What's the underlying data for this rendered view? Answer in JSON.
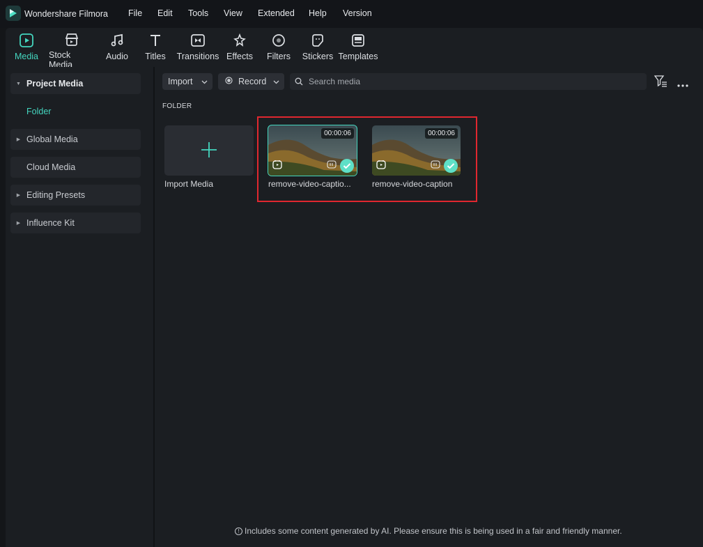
{
  "app": {
    "title": "Wondershare Filmora",
    "menu": [
      "File",
      "Edit",
      "Tools",
      "View",
      "Extended",
      "Help",
      "Version"
    ]
  },
  "toolbar": {
    "tabs": [
      {
        "label": "Media",
        "icon": "media-icon",
        "active": true
      },
      {
        "label": "Stock Media",
        "icon": "stock-media-icon"
      },
      {
        "label": "Audio",
        "icon": "audio-icon"
      },
      {
        "label": "Titles",
        "icon": "titles-icon"
      },
      {
        "label": "Transitions",
        "icon": "transitions-icon"
      },
      {
        "label": "Effects",
        "icon": "effects-icon"
      },
      {
        "label": "Filters",
        "icon": "filters-icon"
      },
      {
        "label": "Stickers",
        "icon": "stickers-icon"
      },
      {
        "label": "Templates",
        "icon": "templates-icon"
      }
    ]
  },
  "sidebar": {
    "project_media": "Project Media",
    "folder": "Folder",
    "global_media": "Global Media",
    "cloud_media": "Cloud Media",
    "editing_presets": "Editing Presets",
    "influence_kit": "Influence Kit"
  },
  "main": {
    "import_label": "Import",
    "record_label": "Record",
    "search_placeholder": "Search media",
    "folder_header": "FOLDER",
    "import_media_label": "Import Media",
    "clips": [
      {
        "name": "remove-video-captio...",
        "duration": "00:00:06",
        "selected": true
      },
      {
        "name": "remove-video-caption",
        "duration": "00:00:06",
        "selected": false
      }
    ],
    "footer_note": "Includes some content generated by AI. Please ensure this is being used in a fair and friendly manner."
  },
  "colors": {
    "accent": "#44d6bf",
    "highlight": "#e0272f",
    "panel": "#1b1e22"
  }
}
